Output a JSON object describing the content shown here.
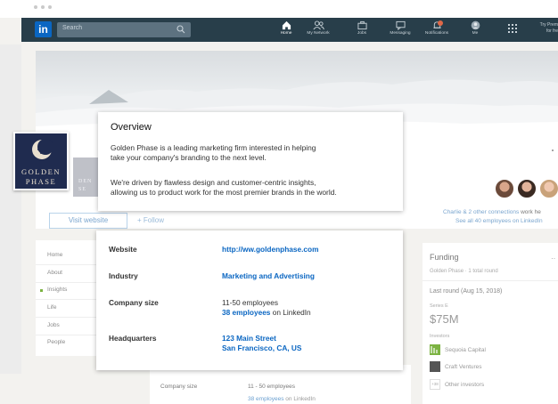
{
  "navbar": {
    "logo": "in",
    "search_placeholder": "Search",
    "items": [
      {
        "label": "Home",
        "icon": "home-icon"
      },
      {
        "label": "My Network",
        "icon": "people-icon"
      },
      {
        "label": "Jobs",
        "icon": "briefcase-icon"
      },
      {
        "label": "Messaging",
        "icon": "chat-icon"
      },
      {
        "label": "Notifications",
        "icon": "bell-icon"
      },
      {
        "label": "Me",
        "icon": "avatar-icon"
      }
    ],
    "premium_line1": "Try Prem",
    "premium_line2": "for fre"
  },
  "company": {
    "logo_line1": "GOLDEN",
    "logo_line2": "PHASE",
    "small_logo_line1": "DEN",
    "small_logo_line2": "SE",
    "visit_label": "Visit website",
    "follow_label": "+ Follow",
    "connections_link": "Charlie & 2 other connections",
    "connections_suffix": " work he",
    "employees_link": "See all 40 employees on LinkedIn"
  },
  "left_nav": {
    "items": [
      "Home",
      "About",
      "Insights",
      "Life",
      "Jobs",
      "People"
    ]
  },
  "center_card": {
    "company_size_label": "Company size",
    "company_size_value": "11 - 50 employees",
    "employees_link": "38 employees",
    "employees_suffix": " on LinkedIn"
  },
  "funding": {
    "title": "Funding",
    "subtitle": "Golden Phase · 1 total round",
    "last_round": "Last round (Aug 15, 2018)",
    "series": "Series E",
    "amount": "$75M",
    "investors_label": "Investors",
    "investors": [
      "Sequoia Capital",
      "Craft Ventures",
      "Other investors"
    ],
    "other_count": "+38",
    "more": "··",
    "colors": {
      "sequoia": "#7cb342",
      "craft": "#555555"
    }
  },
  "overview": {
    "title": "Overview",
    "para1_line1": "Golden Phase is a leading marketing firm interested in helping",
    "para1_line2": "take your company's branding to the next level.",
    "para2_line1": "We're driven by flawless design and customer-centric insights,",
    "para2_line2": "allowing us to product work for the most premier brands in the world."
  },
  "details": {
    "website_label": "Website",
    "website_value": "http://ww.goldenphase.com",
    "industry_label": "Industry",
    "industry_value": "Marketing and Advertising",
    "size_label": "Company size",
    "size_value": "11-50 employees",
    "size_link": "38 employees",
    "size_suffix": " on LinkedIn",
    "hq_label": "Headquarters",
    "hq_line1": "123 Main Street",
    "hq_line2": "San Francisco, CA, US"
  },
  "colors": {
    "nav_bg": "#283e4a",
    "link": "#0a66c2",
    "logo_bg": "#1f2b4f"
  }
}
